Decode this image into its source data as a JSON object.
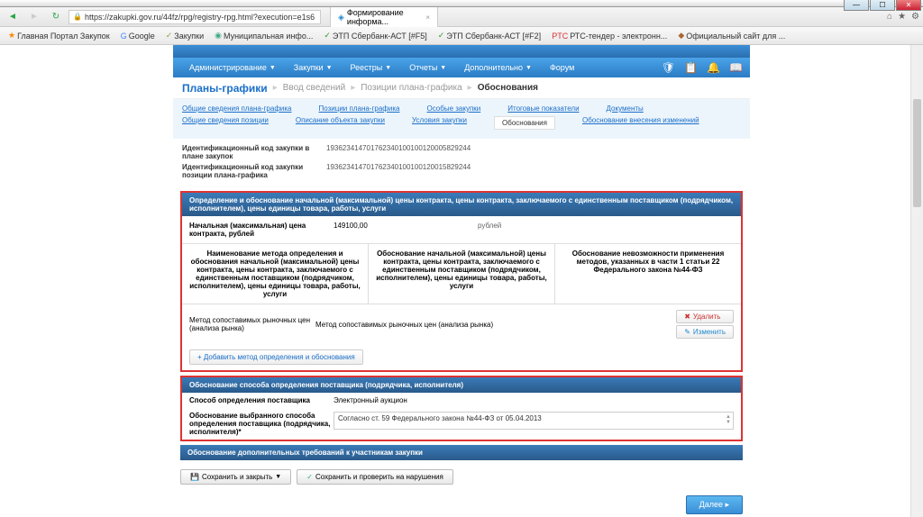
{
  "window": {
    "min": "—",
    "max": "☐",
    "close": "✕"
  },
  "browser": {
    "url": "https://zakupki.gov.ru/44fz/rpg/registry-rpg.html?execution=e1s6",
    "tab_title": "Формирование информа...",
    "tab_close": "×"
  },
  "bookmarks": [
    "Главная Портал Закупок",
    "Google",
    "Закупки",
    "Муниципальная инфо...",
    "ЭТП Сбербанк-АСТ [#F5]",
    "ЭТП Сбербанк-АСТ [#F2]",
    "РТС-тендер - электронн...",
    "Официальный сайт для ..."
  ],
  "nav": {
    "items": [
      "Администрирование",
      "Закупки",
      "Реестры",
      "Отчеты",
      "Дополнительно",
      "Форум"
    ]
  },
  "breadcrumb": {
    "main": "Планы-графики",
    "items": [
      "Ввод сведений",
      "Позиции плана-графика"
    ],
    "active": "Обоснования"
  },
  "subtabs": {
    "row1": [
      "Общие сведения плана-графика",
      "Позиции плана-графика",
      "Особые закупки",
      "Итоговые показатели",
      "Документы"
    ],
    "row2": [
      "Общие сведения позиции",
      "Описание объекта закупки",
      "Условия закупки",
      "Обоснования",
      "Обоснование внесения изменений"
    ],
    "active": "Обоснования"
  },
  "info": {
    "label1": "Идентификационный код закупки в плане закупок",
    "value1": "193623414701762340100100120005829244",
    "label2": "Идентификационный код закупки позиции плана-графика",
    "value2": "193623414701762340100100120015829244"
  },
  "section1": {
    "title": "Определение и обоснование начальной (максимальной) цены контракта, цены контракта, заключаемого с единственным поставщиком (подрядчиком, исполнителем), цены единицы товара, работы, услуги",
    "price_label": "Начальная (максимальная) цена контракта, рублей",
    "price_value": "149100,00",
    "price_currency": "рублей",
    "col1_head": "Наименование метода определения и обоснования начальной (максимальной) цены контракта, цены контракта, заключаемого с единственным поставщиком (подрядчиком, исполнителем), цены единицы товара, работы, услуги",
    "col2_head": "Обоснование начальной (максимальной) цены контракта, цены контракта, заключаемого с единственным поставщиком (подрядчиком, исполнителем), цены единицы товара, работы, услуги",
    "col3_head": "Обоснование невозможности применения методов, указанных в части 1 статьи 22 Федерального закона №44-ФЗ",
    "method_name": "Метод сопоставимых рыночных цен (анализа рынка)",
    "method_desc": "Метод сопоставимых рыночных цен (анализа рынка)",
    "btn_delete": "Удалить",
    "btn_edit": "Изменить",
    "btn_add": "Добавить метод определения и обоснования"
  },
  "section2": {
    "title": "Обоснование способа определения поставщика (подрядчика, исполнителя)",
    "row1_label": "Способ определения поставщика",
    "row1_value": "Электронный аукцион",
    "row2_label": "Обоснование выбранного способа определения поставщика (подрядчика, исполнителя)*",
    "row2_value": "Согласно ст. 59 Федерального закона №44-ФЗ от 05.04.2013"
  },
  "section3": {
    "title": "Обоснование дополнительных требований к участникам закупки"
  },
  "buttons": {
    "save_close": "Сохранить и закрыть",
    "save_check": "Сохранить и проверить на нарушения",
    "next": "Далее"
  }
}
